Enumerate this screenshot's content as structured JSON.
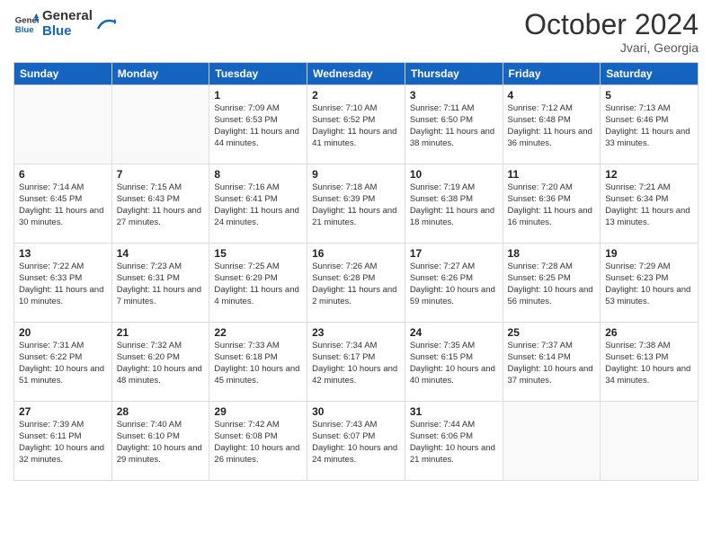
{
  "header": {
    "logo_line1": "General",
    "logo_line2": "Blue",
    "month": "October 2024",
    "location": "Jvari, Georgia"
  },
  "days_of_week": [
    "Sunday",
    "Monday",
    "Tuesday",
    "Wednesday",
    "Thursday",
    "Friday",
    "Saturday"
  ],
  "weeks": [
    [
      {
        "num": "",
        "sunrise": "",
        "sunset": "",
        "daylight": "",
        "empty": true
      },
      {
        "num": "",
        "sunrise": "",
        "sunset": "",
        "daylight": "",
        "empty": true
      },
      {
        "num": "1",
        "sunrise": "Sunrise: 7:09 AM",
        "sunset": "Sunset: 6:53 PM",
        "daylight": "Daylight: 11 hours and 44 minutes.",
        "empty": false
      },
      {
        "num": "2",
        "sunrise": "Sunrise: 7:10 AM",
        "sunset": "Sunset: 6:52 PM",
        "daylight": "Daylight: 11 hours and 41 minutes.",
        "empty": false
      },
      {
        "num": "3",
        "sunrise": "Sunrise: 7:11 AM",
        "sunset": "Sunset: 6:50 PM",
        "daylight": "Daylight: 11 hours and 38 minutes.",
        "empty": false
      },
      {
        "num": "4",
        "sunrise": "Sunrise: 7:12 AM",
        "sunset": "Sunset: 6:48 PM",
        "daylight": "Daylight: 11 hours and 36 minutes.",
        "empty": false
      },
      {
        "num": "5",
        "sunrise": "Sunrise: 7:13 AM",
        "sunset": "Sunset: 6:46 PM",
        "daylight": "Daylight: 11 hours and 33 minutes.",
        "empty": false
      }
    ],
    [
      {
        "num": "6",
        "sunrise": "Sunrise: 7:14 AM",
        "sunset": "Sunset: 6:45 PM",
        "daylight": "Daylight: 11 hours and 30 minutes.",
        "empty": false
      },
      {
        "num": "7",
        "sunrise": "Sunrise: 7:15 AM",
        "sunset": "Sunset: 6:43 PM",
        "daylight": "Daylight: 11 hours and 27 minutes.",
        "empty": false
      },
      {
        "num": "8",
        "sunrise": "Sunrise: 7:16 AM",
        "sunset": "Sunset: 6:41 PM",
        "daylight": "Daylight: 11 hours and 24 minutes.",
        "empty": false
      },
      {
        "num": "9",
        "sunrise": "Sunrise: 7:18 AM",
        "sunset": "Sunset: 6:39 PM",
        "daylight": "Daylight: 11 hours and 21 minutes.",
        "empty": false
      },
      {
        "num": "10",
        "sunrise": "Sunrise: 7:19 AM",
        "sunset": "Sunset: 6:38 PM",
        "daylight": "Daylight: 11 hours and 18 minutes.",
        "empty": false
      },
      {
        "num": "11",
        "sunrise": "Sunrise: 7:20 AM",
        "sunset": "Sunset: 6:36 PM",
        "daylight": "Daylight: 11 hours and 16 minutes.",
        "empty": false
      },
      {
        "num": "12",
        "sunrise": "Sunrise: 7:21 AM",
        "sunset": "Sunset: 6:34 PM",
        "daylight": "Daylight: 11 hours and 13 minutes.",
        "empty": false
      }
    ],
    [
      {
        "num": "13",
        "sunrise": "Sunrise: 7:22 AM",
        "sunset": "Sunset: 6:33 PM",
        "daylight": "Daylight: 11 hours and 10 minutes.",
        "empty": false
      },
      {
        "num": "14",
        "sunrise": "Sunrise: 7:23 AM",
        "sunset": "Sunset: 6:31 PM",
        "daylight": "Daylight: 11 hours and 7 minutes.",
        "empty": false
      },
      {
        "num": "15",
        "sunrise": "Sunrise: 7:25 AM",
        "sunset": "Sunset: 6:29 PM",
        "daylight": "Daylight: 11 hours and 4 minutes.",
        "empty": false
      },
      {
        "num": "16",
        "sunrise": "Sunrise: 7:26 AM",
        "sunset": "Sunset: 6:28 PM",
        "daylight": "Daylight: 11 hours and 2 minutes.",
        "empty": false
      },
      {
        "num": "17",
        "sunrise": "Sunrise: 7:27 AM",
        "sunset": "Sunset: 6:26 PM",
        "daylight": "Daylight: 10 hours and 59 minutes.",
        "empty": false
      },
      {
        "num": "18",
        "sunrise": "Sunrise: 7:28 AM",
        "sunset": "Sunset: 6:25 PM",
        "daylight": "Daylight: 10 hours and 56 minutes.",
        "empty": false
      },
      {
        "num": "19",
        "sunrise": "Sunrise: 7:29 AM",
        "sunset": "Sunset: 6:23 PM",
        "daylight": "Daylight: 10 hours and 53 minutes.",
        "empty": false
      }
    ],
    [
      {
        "num": "20",
        "sunrise": "Sunrise: 7:31 AM",
        "sunset": "Sunset: 6:22 PM",
        "daylight": "Daylight: 10 hours and 51 minutes.",
        "empty": false
      },
      {
        "num": "21",
        "sunrise": "Sunrise: 7:32 AM",
        "sunset": "Sunset: 6:20 PM",
        "daylight": "Daylight: 10 hours and 48 minutes.",
        "empty": false
      },
      {
        "num": "22",
        "sunrise": "Sunrise: 7:33 AM",
        "sunset": "Sunset: 6:18 PM",
        "daylight": "Daylight: 10 hours and 45 minutes.",
        "empty": false
      },
      {
        "num": "23",
        "sunrise": "Sunrise: 7:34 AM",
        "sunset": "Sunset: 6:17 PM",
        "daylight": "Daylight: 10 hours and 42 minutes.",
        "empty": false
      },
      {
        "num": "24",
        "sunrise": "Sunrise: 7:35 AM",
        "sunset": "Sunset: 6:15 PM",
        "daylight": "Daylight: 10 hours and 40 minutes.",
        "empty": false
      },
      {
        "num": "25",
        "sunrise": "Sunrise: 7:37 AM",
        "sunset": "Sunset: 6:14 PM",
        "daylight": "Daylight: 10 hours and 37 minutes.",
        "empty": false
      },
      {
        "num": "26",
        "sunrise": "Sunrise: 7:38 AM",
        "sunset": "Sunset: 6:13 PM",
        "daylight": "Daylight: 10 hours and 34 minutes.",
        "empty": false
      }
    ],
    [
      {
        "num": "27",
        "sunrise": "Sunrise: 7:39 AM",
        "sunset": "Sunset: 6:11 PM",
        "daylight": "Daylight: 10 hours and 32 minutes.",
        "empty": false
      },
      {
        "num": "28",
        "sunrise": "Sunrise: 7:40 AM",
        "sunset": "Sunset: 6:10 PM",
        "daylight": "Daylight: 10 hours and 29 minutes.",
        "empty": false
      },
      {
        "num": "29",
        "sunrise": "Sunrise: 7:42 AM",
        "sunset": "Sunset: 6:08 PM",
        "daylight": "Daylight: 10 hours and 26 minutes.",
        "empty": false
      },
      {
        "num": "30",
        "sunrise": "Sunrise: 7:43 AM",
        "sunset": "Sunset: 6:07 PM",
        "daylight": "Daylight: 10 hours and 24 minutes.",
        "empty": false
      },
      {
        "num": "31",
        "sunrise": "Sunrise: 7:44 AM",
        "sunset": "Sunset: 6:06 PM",
        "daylight": "Daylight: 10 hours and 21 minutes.",
        "empty": false
      },
      {
        "num": "",
        "sunrise": "",
        "sunset": "",
        "daylight": "",
        "empty": true
      },
      {
        "num": "",
        "sunrise": "",
        "sunset": "",
        "daylight": "",
        "empty": true
      }
    ]
  ]
}
